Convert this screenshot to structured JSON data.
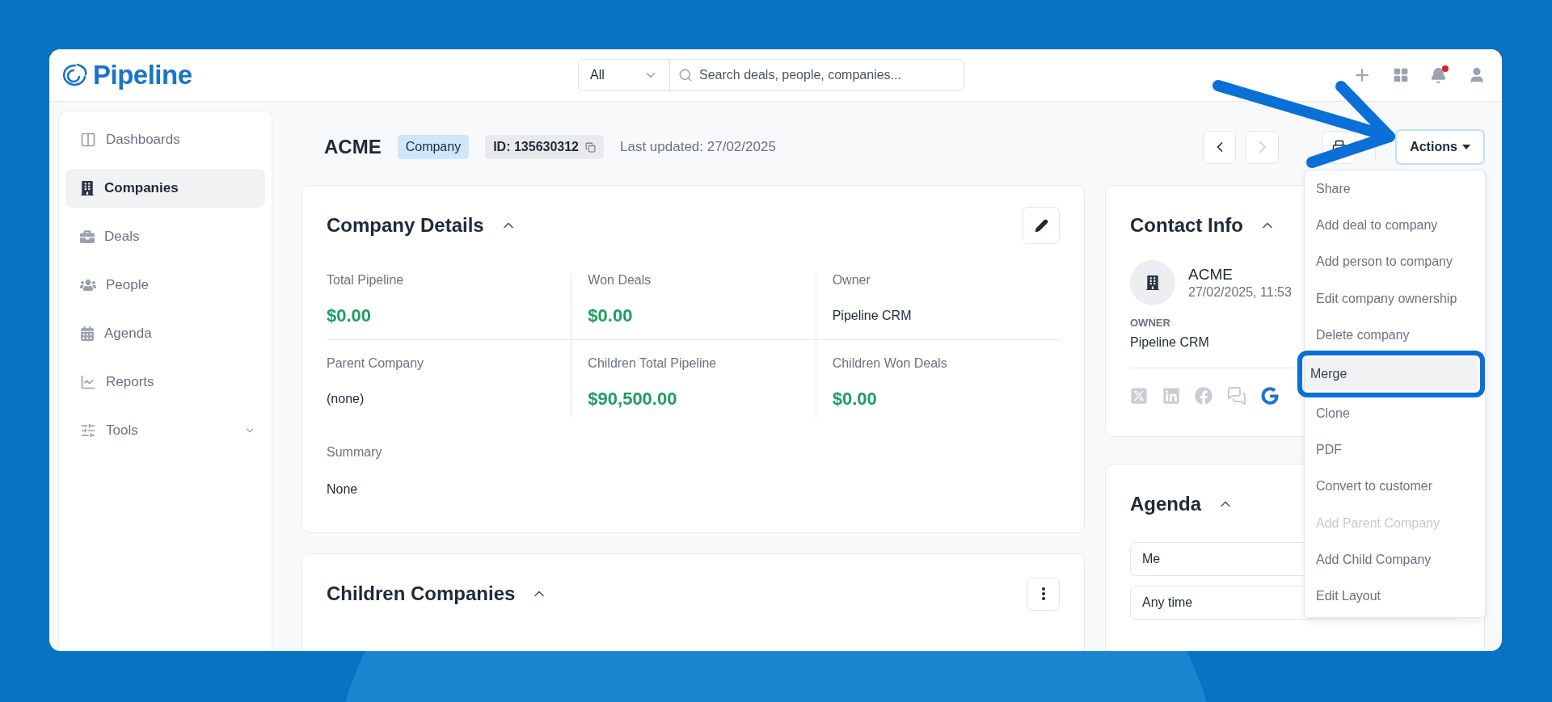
{
  "app": {
    "logo": "Pipeline",
    "notification_dot": true
  },
  "search": {
    "scope": "All",
    "placeholder": "Search deals, people, companies..."
  },
  "sidebar": {
    "items": [
      {
        "label": "Dashboards",
        "kind": "link",
        "selected": false
      },
      {
        "label": "Companies",
        "kind": "link",
        "selected": true
      },
      {
        "label": "Deals",
        "kind": "link",
        "selected": false
      },
      {
        "label": "People",
        "kind": "link",
        "selected": false
      },
      {
        "label": "Agenda",
        "kind": "link",
        "selected": false
      },
      {
        "label": "Reports",
        "kind": "link",
        "selected": false
      },
      {
        "label": "Tools",
        "kind": "group",
        "selected": false
      }
    ]
  },
  "record": {
    "name": "ACME",
    "type_badge": "Company",
    "id": "ID: 135630312",
    "last_updated": "Last updated: 27/02/2025"
  },
  "toolbar": {
    "prev_disabled": false,
    "next_disabled": true,
    "actions_label": "Actions"
  },
  "company_details": {
    "title": "Company Details",
    "fields": [
      {
        "label": "Total Pipeline",
        "value": "$0.00",
        "kind": "money"
      },
      {
        "label": "Won Deals",
        "value": "$0.00",
        "kind": "money"
      },
      {
        "label": "Owner",
        "value": "Pipeline CRM",
        "kind": "text"
      },
      {
        "label": "Parent Company",
        "value": "(none)",
        "kind": "text"
      },
      {
        "label": "Children Total Pipeline",
        "value": "$90,500.00",
        "kind": "money"
      },
      {
        "label": "Children Won Deals",
        "value": "$0.00",
        "kind": "money"
      }
    ],
    "summary": {
      "label": "Summary",
      "value": "None"
    }
  },
  "children_companies": {
    "title": "Children Companies"
  },
  "contact_info": {
    "title": "Contact Info",
    "name": "ACME",
    "date": "27/02/2025, 11:53",
    "owner_label": "OWNER",
    "owner": "Pipeline CRM",
    "socials": [
      {
        "kind": "x",
        "active": false
      },
      {
        "kind": "linkedin",
        "active": false
      },
      {
        "kind": "facebook",
        "active": false
      },
      {
        "kind": "chat",
        "active": false
      },
      {
        "kind": "google",
        "active": true
      }
    ]
  },
  "agenda": {
    "title": "Agenda",
    "filters": [
      {
        "value": "Me"
      },
      {
        "value": "Any time"
      }
    ]
  },
  "actions_menu": {
    "items": [
      {
        "label": "Share",
        "disabled": false,
        "highlighted": false
      },
      {
        "label": "Add deal to company",
        "disabled": false,
        "highlighted": false
      },
      {
        "label": "Add person to company",
        "disabled": false,
        "highlighted": false
      },
      {
        "label": "Edit company ownership",
        "disabled": false,
        "highlighted": false
      },
      {
        "label": "Delete company",
        "disabled": false,
        "highlighted": false
      },
      {
        "label": "Merge",
        "disabled": false,
        "highlighted": true
      },
      {
        "label": "Clone",
        "disabled": false,
        "highlighted": false
      },
      {
        "label": "PDF",
        "disabled": false,
        "highlighted": false
      },
      {
        "label": "Convert to customer",
        "disabled": false,
        "highlighted": false
      },
      {
        "label": "Add Parent Company",
        "disabled": true,
        "highlighted": false
      },
      {
        "label": "Add Child Company",
        "disabled": false,
        "highlighted": false
      },
      {
        "label": "Edit Layout",
        "disabled": false,
        "highlighted": false
      }
    ]
  }
}
